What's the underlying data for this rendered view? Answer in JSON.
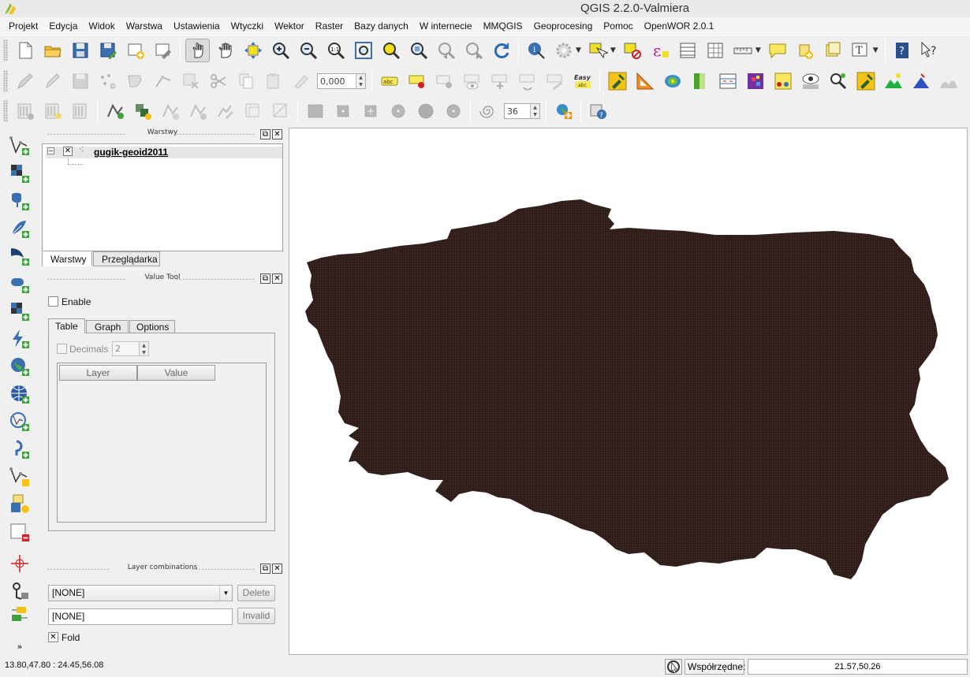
{
  "window": {
    "title": "QGIS 2.2.0-Valmiera"
  },
  "menu": [
    "Projekt",
    "Edycja",
    "Widok",
    "Warstwa",
    "Ustawienia",
    "Wtyczki",
    "Wektor",
    "Raster",
    "Bazy danych",
    "W internecie",
    "MMQGIS",
    "Geoprocesing",
    "Pomoc",
    "OpenWOR 2.0.1"
  ],
  "toolbar2": {
    "scale_value": "0,000",
    "label_abc": "abc",
    "easy_top": "Easy",
    "easy_bottom": "abc"
  },
  "toolbar3": {
    "segments_value": "36"
  },
  "layers_panel": {
    "title": "Warstwy",
    "layer_name": "gugik-geoid2011",
    "tabs": [
      "Warstwy",
      "Przeglądarka"
    ]
  },
  "value_tool": {
    "title": "Value Tool",
    "enable_label": "Enable",
    "tabs": [
      "Table",
      "Graph",
      "Options"
    ],
    "decimals_label": "Decimals",
    "decimals_value": "2",
    "columns": [
      "Layer",
      "Value"
    ]
  },
  "layer_combinations": {
    "title": "Layer combinations",
    "combo_value": "[NONE]",
    "name_value": "[NONE]",
    "delete_label": "Delete",
    "invalid_label": "Invalid",
    "fold_label": "Fold"
  },
  "statusbar": {
    "extent": "13.80,47.80 : 24.45,56.08",
    "coords_label": "Współrzędne:",
    "coords_value": "21.57,50.26"
  },
  "colors": {
    "raster_fill": "#2a1a18",
    "raster_grid": "#3c2622",
    "toolbar_bg": "#f0f0f0"
  }
}
